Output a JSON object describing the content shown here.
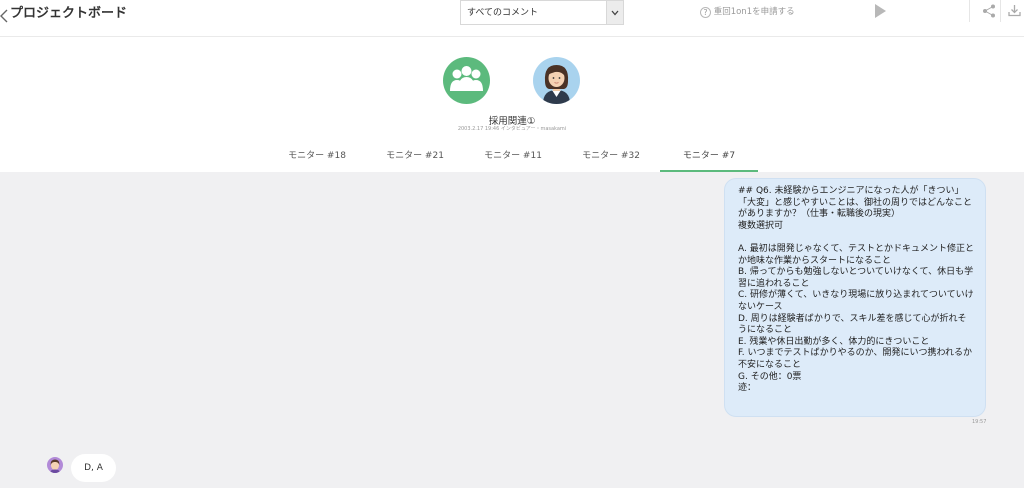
{
  "header": {
    "back_icon": "chevron-left-icon",
    "title": "プロジェクトボード",
    "filter": {
      "selected": "すべてのコメント",
      "caret_icon": "chevron-down-icon"
    },
    "request_label": "重回1on1を申請する",
    "request_icon": "help-circle-icon",
    "play_icon": "play-icon",
    "share_icon": "share-icon",
    "download_icon": "download-icon"
  },
  "board": {
    "name": "採用関連①",
    "meta": "2003.2.17 19:46 インタビュアー・masakami"
  },
  "tabs": [
    {
      "label": "モニター #18"
    },
    {
      "label": "モニター #21"
    },
    {
      "label": "モニター #11"
    },
    {
      "label": "モニター #32"
    },
    {
      "label": "モニター #7",
      "active": true
    }
  ],
  "message": {
    "text": "## Q6. 未経験からエンジニアになった人が「きつい」「大変」と感じやすいことは、御社の周りではどんなことがありますか？（仕事・転職後の現実）\n複数選択可\n\nA. 最初は開発じゃなくて、テストとかドキュメント修正とか地味な作業からスタートになること\nB. 帰ってからも勉強しないとついていけなくて、休日も学習に追われること\nC. 研修が薄くて、いきなり現場に放り込まれてついていけないケース\nD. 周りは経験者ばかりで、スキル差を感じて心が折れそうになること\nE. 残業や休日出勤が多く、体力的にきついこと\nF. いつまでテストばかりやるのか、開発にいつ携われるか不安になること\nG. その他：0票\n迹：",
    "time": "19:57"
  },
  "reply": {
    "text": "D, A"
  },
  "colors": {
    "accent": "#5cba7d",
    "bubble": "#ddebf9",
    "chat_bg": "#f0f0f2"
  }
}
